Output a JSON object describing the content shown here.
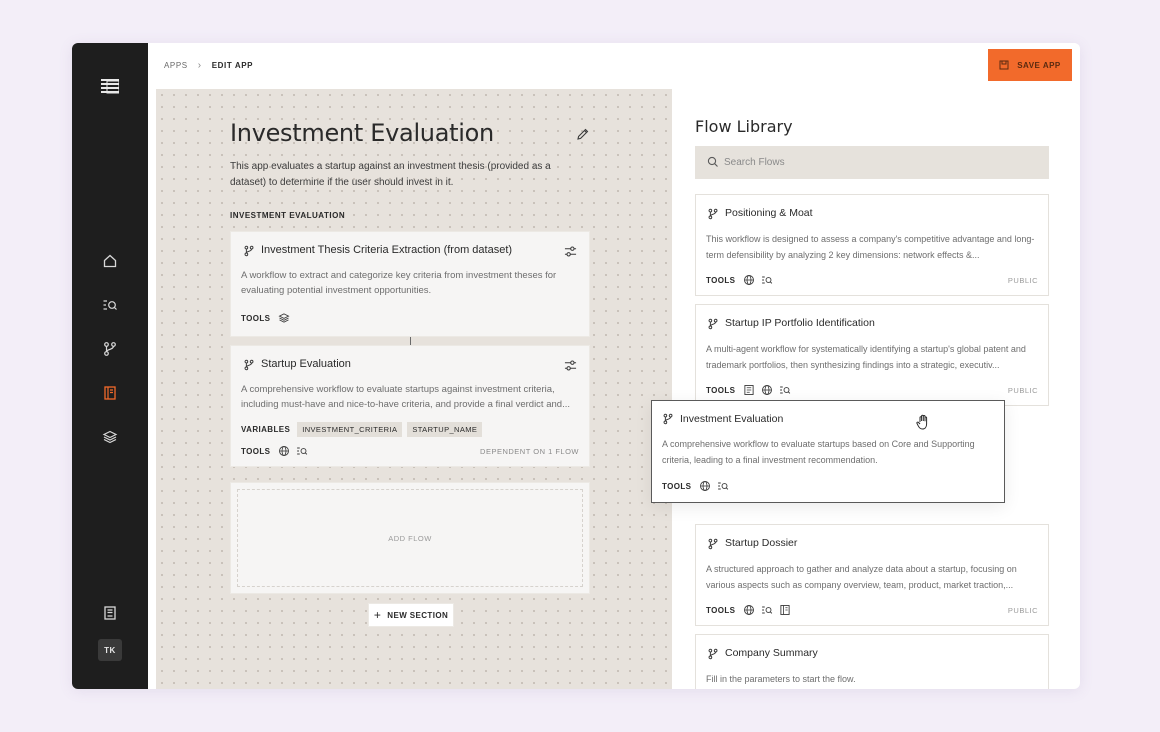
{
  "colors": {
    "accent": "#f26a2b",
    "sidebar": "#1e1e1e",
    "canvas": "#e7e2dc"
  },
  "sidebar": {
    "items": [
      {
        "name": "home-icon"
      },
      {
        "name": "search-list-icon"
      },
      {
        "name": "flow-branch-icon"
      },
      {
        "name": "apps-book-icon",
        "active": true
      },
      {
        "name": "layers-icon"
      }
    ],
    "bottom_icon": "docs-book-icon",
    "avatar": "TK"
  },
  "header": {
    "breadcrumb": [
      "APPS",
      "EDIT APP"
    ],
    "save_label": "SAVE APP"
  },
  "app": {
    "title": "Investment Evaluation",
    "description": "This app evaluates a startup against an investment thesis (provided as a dataset) to determine if the user should invest in it.",
    "section_label": "INVESTMENT EVALUATION",
    "flows": [
      {
        "title": "Investment Thesis Criteria Extraction (from dataset)",
        "description": "A workflow to extract and categorize key criteria from investment theses for evaluating potential investment opportunities.",
        "tools_label": "TOOLS",
        "tools": [
          "layers-icon"
        ]
      },
      {
        "title": "Startup Evaluation",
        "description": "A comprehensive workflow to evaluate startups against investment criteria, including must-have and nice-to-have criteria, and provide a final verdict and...",
        "variables_label": "VARIABLES",
        "variables": [
          "INVESTMENT_CRITERIA",
          "STARTUP_NAME"
        ],
        "tools_label": "TOOLS",
        "tools": [
          "globe-icon",
          "search-list-icon"
        ],
        "dependency": "DEPENDENT ON 1 FLOW"
      }
    ],
    "add_flow_label": "ADD FLOW",
    "new_section_label": "NEW SECTION"
  },
  "library": {
    "title": "Flow Library",
    "search_placeholder": "Search Flows",
    "cards": [
      {
        "title": "Positioning & Moat",
        "description": "This workflow is designed to assess a company's competitive advantage and long-term defensibility by analyzing 2 key dimensions: network effects &...",
        "tools_label": "TOOLS",
        "visibility": "PUBLIC"
      },
      {
        "title": "Startup IP Portfolio Identification",
        "description": "A multi-agent workflow for systematically identifying a startup's global patent and trademark portfolios, then synthesizing findings into a strategic, executiv...",
        "tools_label": "TOOLS",
        "visibility": "PUBLIC"
      },
      {
        "title": "Startup Dossier",
        "description": "A structured approach to gather and analyze data about a startup, focusing on various aspects such as company overview, team, product, market traction,...",
        "tools_label": "TOOLS",
        "visibility": "PUBLIC"
      },
      {
        "title": "Company Summary",
        "description": "Fill in the parameters to start the flow."
      }
    ],
    "dragging": {
      "title": "Investment Evaluation",
      "description": "A comprehensive workflow to evaluate startups based on Core and Supporting criteria, leading to a final investment recommendation.",
      "tools_label": "TOOLS"
    }
  }
}
